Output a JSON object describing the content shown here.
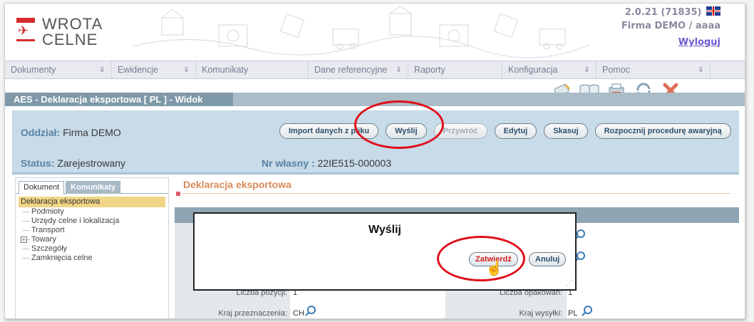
{
  "header": {
    "logo_line1": "WROTA",
    "logo_line2": "CELNE",
    "version": "2.0.21 (71835)",
    "firma": "Firma DEMO / aaaa",
    "logout": "Wyloguj",
    "language_icon": "uk-flag-icon"
  },
  "menu": [
    {
      "label": "Dokumenty"
    },
    {
      "label": "Ewidencje"
    },
    {
      "label": "Komunikaty"
    },
    {
      "label": "Dane referencyjne"
    },
    {
      "label": "Raporty"
    },
    {
      "label": "Konfiguracja"
    },
    {
      "label": "Pomoc"
    }
  ],
  "page_title": "AES - Deklaracja eksportowa [ PL ] - Widok",
  "toolbar_icons": [
    "edit-icon",
    "book-icon",
    "print-icon",
    "refresh-icon",
    "close-icon"
  ],
  "info": {
    "oddzial_label": "Oddział:",
    "oddzial_value": "Firma DEMO",
    "status_label": "Status:",
    "status_value": "Zarejestrowany",
    "nr_label": "Nr własny :",
    "nr_value": "22IE515-000003"
  },
  "actions": {
    "import": "Import danych z pliku",
    "send": "Wyślij",
    "restore": "Przywróć",
    "edit": "Edytuj",
    "delete": "Skasuj",
    "emergency": "Rozpocznij procedurę awaryjną"
  },
  "left_tabs": {
    "document": "Dokument",
    "messages": "Komunikaty"
  },
  "tree": {
    "root": "Deklaracja eksportowa",
    "items": [
      "Podmioty",
      "Urzędy celne i lokalizacja",
      "Transport",
      "Towary",
      "Szczegóły",
      "Zamknięcia celne"
    ]
  },
  "section_title": "Deklaracja eksportowa",
  "fields": {
    "positions_label": "Liczba pozycji:",
    "positions_value": "1",
    "packages_label": "Liczba opakowań:",
    "packages_value": "1",
    "dest_label": "Kraj przeznaczenia:",
    "dest_value": "CH",
    "ship_label": "Kraj wysyłki:",
    "ship_value": "PL"
  },
  "modal": {
    "title": "Wyślij",
    "confirm": "Zatwierdź",
    "cancel": "Anuluj"
  },
  "colors": {
    "annotation": "#e0101a",
    "title_bar": "#7e98a8",
    "info_panel": "#c7dbe8",
    "tree_selected": "#f0d586"
  }
}
